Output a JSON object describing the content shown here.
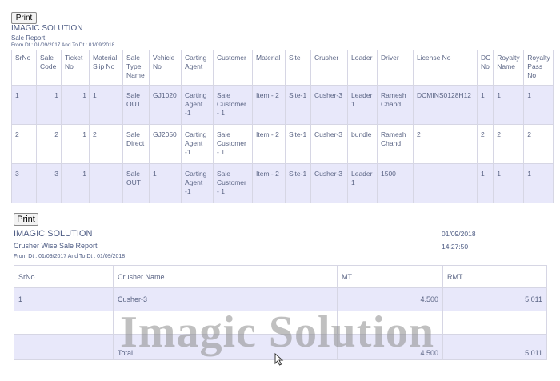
{
  "report1": {
    "print_label": "Print",
    "company": "IMAGIC SOLUTION",
    "title": "Sale Report",
    "date_range": "From Dt : 01/09/2017 And To Dt : 01/09/2018",
    "columns": [
      "SrNo",
      "Sale Code",
      "Ticket No",
      "Material Slip No",
      "Sale Type Name",
      "Vehicle No",
      "Carting Agent",
      "Customer",
      "Material",
      "Site",
      "Crusher",
      "Loader",
      "Driver",
      "License No",
      "DC No",
      "Royalty Name",
      "Royalty Pass No"
    ],
    "rows": [
      [
        "1",
        "1",
        "1",
        "1",
        "Sale OUT",
        "GJ1020",
        "Carting Agent -1",
        "Sale Customer - 1",
        "Item - 2",
        "Site-1",
        "Cusher-3",
        "Leader 1",
        "Ramesh Chand",
        "DCMINS0128H12",
        "1",
        "1",
        "1"
      ],
      [
        "2",
        "2",
        "1",
        "2",
        "Sale Direct",
        "GJ2050",
        "Carting Agent -1",
        "Sale Customer - 1",
        "Item - 2",
        "Site-1",
        "Cusher-3",
        "bundle",
        "Ramesh Chand",
        "2",
        "2",
        "2",
        "2"
      ],
      [
        "3",
        "3",
        "1",
        "",
        "Sale OUT",
        "1",
        "Carting Agent -1",
        "Sale Customer - 1",
        "Item - 2",
        "Site-1",
        "Cusher-3",
        "Leader 1",
        "1500",
        "",
        "1",
        "1",
        "1"
      ]
    ]
  },
  "report2": {
    "print_label": "Print",
    "company": "IMAGIC SOLUTION",
    "title": "Crusher Wise Sale Report",
    "date_range": "From Dt : 01/09/2017 And To Dt : 01/09/2018",
    "date": "01/09/2018",
    "time": "14:27:50",
    "columns": [
      "SrNo",
      "Crusher Name",
      "MT",
      "RMT"
    ],
    "rows": [
      [
        "1",
        "Cusher-3",
        "4.500",
        "5.011"
      ],
      [
        "",
        "",
        "",
        ""
      ],
      [
        "",
        "Total",
        "4.500",
        "5.011"
      ]
    ]
  },
  "watermark": "Imagic Solution",
  "colors": {
    "row_alt": "#e8e8fa",
    "border": "#d6d6e4",
    "text": "#4e5c84"
  },
  "icons": {
    "cursor": "mouse-pointer-icon"
  }
}
